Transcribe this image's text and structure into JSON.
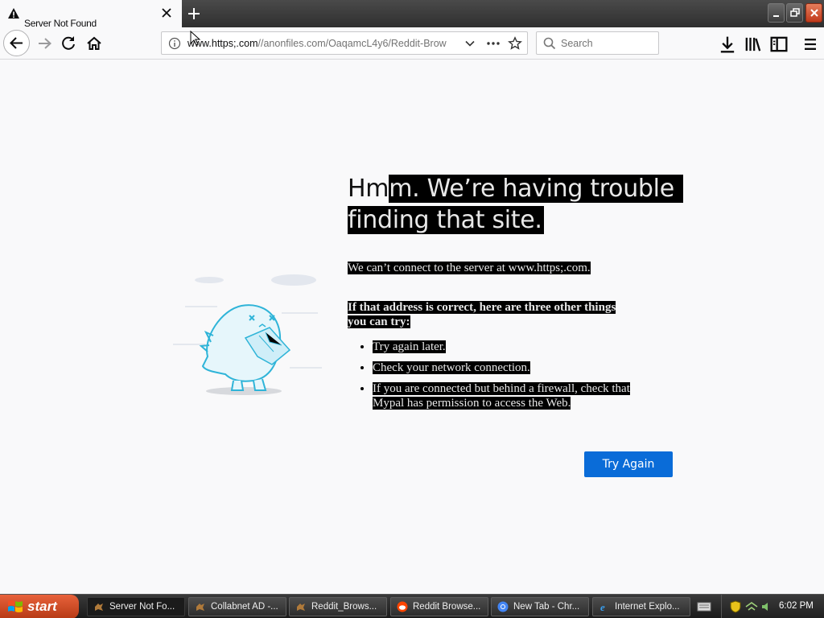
{
  "window": {
    "tab_title": "Server Not Found",
    "new_tab_label": "+"
  },
  "navbar": {
    "url_prefix": "www.https;.com",
    "url_rest": "//anonfiles.com/OaqamcL4y6/Reddit-Brow",
    "search_placeholder": "Search"
  },
  "error_page": {
    "title_line1": "Hmm. We’re having trouble",
    "title_line2": "finding that site.",
    "description": "We can’t connect to the server at www.https;.com.",
    "try_heading_line1": "If that address is correct, here are three other things",
    "try_heading_line2": "you can try:",
    "tips": [
      "Try again later.",
      "Check your network connection.",
      "If you are connected but behind a firewall, check that",
      "Mypal has permission to access the Web."
    ],
    "try_again_label": "Try Again"
  },
  "taskbar": {
    "start_label": "start",
    "items": [
      {
        "label": "Server Not Fo...",
        "icon": "mypal-icon"
      },
      {
        "label": "Collabnet AD -...",
        "icon": "mypal-icon"
      },
      {
        "label": "Reddit_Brows...",
        "icon": "mypal-icon"
      },
      {
        "label": "Reddit Browse...",
        "icon": "reddit-icon"
      },
      {
        "label": "New Tab - Chr...",
        "icon": "chrome-icon"
      },
      {
        "label": "Internet Explo...",
        "icon": "ie-icon"
      }
    ],
    "clock": "6:02 PM"
  },
  "colors": {
    "accent": "#0a6cd8",
    "highlight_bg": "#000000",
    "page_bg": "#f9f9fa"
  }
}
